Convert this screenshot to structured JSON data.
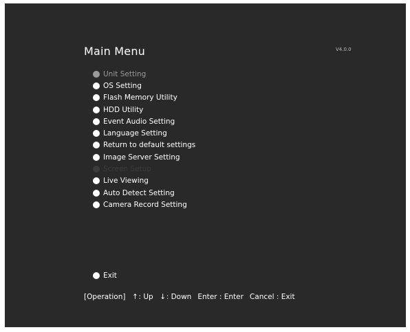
{
  "menu": {
    "title": "Main Menu",
    "version": "V4.0.0",
    "items": [
      {
        "label": "Unit Setting",
        "state": "selected"
      },
      {
        "label": "OS Setting",
        "state": "normal"
      },
      {
        "label": "Flash Memory Utility",
        "state": "normal"
      },
      {
        "label": "HDD Utility",
        "state": "normal"
      },
      {
        "label": "Event Audio Setting",
        "state": "normal"
      },
      {
        "label": "Language Setting",
        "state": "normal"
      },
      {
        "label": "Return to default settings",
        "state": "normal"
      },
      {
        "label": "Image Server Setting",
        "state": "normal"
      },
      {
        "label": "Screen Setup",
        "state": "disabled"
      },
      {
        "label": "Live Viewing",
        "state": "normal"
      },
      {
        "label": "Auto Detect Setting",
        "state": "normal"
      },
      {
        "label": "Camera Record Setting",
        "state": "normal"
      }
    ],
    "exit_label": "Exit"
  },
  "help": {
    "operation": "[Operation]",
    "up_arrow": "↑",
    "up": ": Up",
    "down_arrow": "↓",
    "down": ": Down",
    "enter": "Enter : Enter",
    "cancel": "Cancel : Exit"
  },
  "colors": {
    "background": "#292929",
    "text": "#ffffff",
    "selected": "#9a9a9a",
    "disabled": "#3b3b3b"
  }
}
